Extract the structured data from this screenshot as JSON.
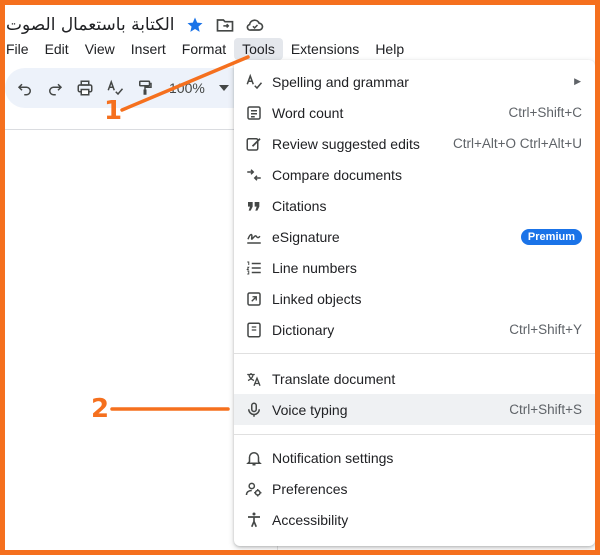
{
  "document": {
    "title": "الكتابة باستعمال الصوت"
  },
  "title_icons": [
    "star-icon",
    "move-to-folder-icon",
    "cloud-status-icon"
  ],
  "menubar": {
    "items": [
      "File",
      "Edit",
      "View",
      "Insert",
      "Format",
      "Tools",
      "Extensions",
      "Help"
    ],
    "active": "Tools"
  },
  "toolbar": {
    "zoom": "100%"
  },
  "tools_menu": {
    "items": [
      {
        "label": "Spelling and grammar",
        "icon": "spellcheck-icon",
        "submenu": true
      },
      {
        "label": "Word count",
        "icon": "word-count-icon",
        "shortcut": "Ctrl+Shift+C"
      },
      {
        "label": "Review suggested edits",
        "icon": "review-edits-icon",
        "shortcut": "Ctrl+Alt+O Ctrl+Alt+U"
      },
      {
        "label": "Compare documents",
        "icon": "compare-icon"
      },
      {
        "label": "Citations",
        "icon": "quote-icon"
      },
      {
        "label": "eSignature",
        "icon": "signature-icon",
        "badge": "Premium"
      },
      {
        "label": "Line numbers",
        "icon": "line-numbers-icon"
      },
      {
        "label": "Linked objects",
        "icon": "linked-objects-icon"
      },
      {
        "label": "Dictionary",
        "icon": "dictionary-icon",
        "shortcut": "Ctrl+Shift+Y"
      },
      {
        "label": "Translate document",
        "icon": "translate-icon"
      },
      {
        "label": "Voice typing",
        "icon": "microphone-icon",
        "shortcut": "Ctrl+Shift+S",
        "highlighted": true
      },
      {
        "label": "Notification settings",
        "icon": "bell-icon"
      },
      {
        "label": "Preferences",
        "icon": "preferences-icon"
      },
      {
        "label": "Accessibility",
        "icon": "accessibility-icon"
      }
    ]
  },
  "annotations": {
    "step1": "1",
    "step2": "2"
  },
  "colors": {
    "annotation": "#f5701e",
    "premium_badge": "#1a73e8",
    "star": "#1a73e8",
    "toolbar_bg": "#edf2fa",
    "highlight_row": "#eff1f3"
  }
}
